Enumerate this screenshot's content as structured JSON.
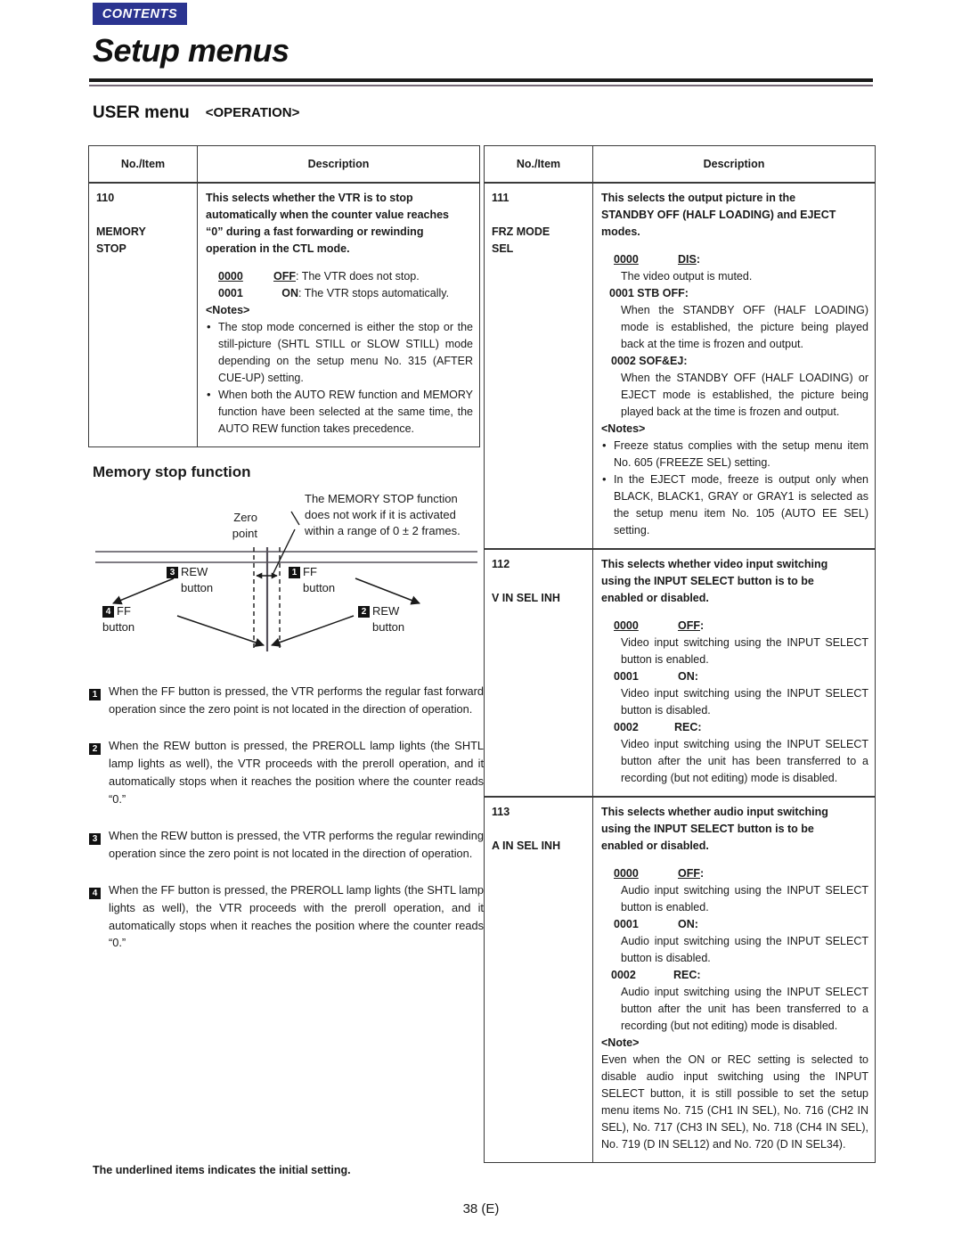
{
  "header": {
    "contents_badge": "CONTENTS",
    "title": "Setup menus",
    "section_title": "USER menu",
    "section_subtitle": "<OPERATION>"
  },
  "table_headers": {
    "col1": "No./Item",
    "col2": "Description"
  },
  "left_table": {
    "rows": [
      {
        "number": "110",
        "item": "MEMORY\nSTOP",
        "item_line1": "MEMORY",
        "item_line2": "STOP",
        "lead_lines": [
          "This selects whether the VTR is to stop",
          "automatically when the counter value reaches",
          "“0” during a fast forwarding or rewinding",
          "operation in the CTL mode."
        ],
        "options": [
          {
            "code": "0000",
            "code_underlined": true,
            "value": "OFF",
            "value_underlined": true,
            "text": ": The VTR does not stop."
          },
          {
            "code": "0001",
            "code_underlined": false,
            "value": "ON",
            "value_underlined": false,
            "text": ": The VTR stops automatically."
          }
        ],
        "notes_heading": "<Notes>",
        "notes": [
          "The stop mode concerned is either the stop or the still-picture (SHTL STILL or SLOW STILL) mode depending on the setup menu No. 315 (AFTER CUE-UP) setting.",
          "When both the AUTO REW function and MEMORY function have been selected at the same time, the AUTO REW function takes precedence."
        ]
      }
    ]
  },
  "right_table": {
    "rows": [
      {
        "number": "111",
        "item_line1": "FRZ MODE",
        "item_line2": "SEL",
        "lead_lines": [
          "This selects the output picture in the",
          "STANDBY OFF (HALF LOADING) and EJECT",
          "modes."
        ],
        "options": [
          {
            "code": "0000",
            "code_underlined": true,
            "value": "DIS",
            "value_underlined": true,
            "suffix": ":",
            "body": "The video output is muted."
          },
          {
            "code": "0001",
            "code_underlined": false,
            "value": "STB OFF",
            "value_underlined": false,
            "suffix": ":",
            "tight": true,
            "body": "When the STANDBY OFF (HALF LOADING) mode is established, the picture being played back at the time is frozen and output."
          },
          {
            "code": "0002",
            "code_underlined": false,
            "value": "SOF&EJ",
            "value_underlined": false,
            "suffix": ":",
            "tight": true,
            "body": "When the STANDBY OFF (HALF LOADING) or EJECT mode is established, the picture being played back at the time is frozen and output."
          }
        ],
        "notes_heading": "<Notes>",
        "notes": [
          "Freeze status complies with the setup menu item No. 605 (FREEZE SEL) setting.",
          "In the EJECT mode, freeze is output only when BLACK, BLACK1, GRAY or GRAY1 is selected as the setup menu item No. 105 (AUTO EE SEL) setting."
        ]
      },
      {
        "number": "112",
        "item_line1": "V IN SEL INH",
        "item_line2": "",
        "lead_lines": [
          "This selects whether video input switching",
          "using the INPUT SELECT button is to be",
          "enabled or disabled."
        ],
        "options": [
          {
            "code": "0000",
            "code_underlined": true,
            "value": "OFF",
            "value_underlined": true,
            "suffix": ":",
            "body": "Video input switching using the INPUT SELECT button is enabled."
          },
          {
            "code": "0001",
            "code_underlined": false,
            "value": "ON",
            "value_underlined": false,
            "suffix": ":",
            "body": "Video input switching using the INPUT SELECT button is disabled."
          },
          {
            "code": "0002",
            "code_underlined": false,
            "value": "REC",
            "value_underlined": false,
            "suffix": ":",
            "body": "Video input switching using the INPUT SELECT button after the unit has been transferred to a recording (but not editing) mode is disabled."
          }
        ],
        "notes_heading": "",
        "notes": []
      },
      {
        "number": "113",
        "item_line1": "A IN SEL INH",
        "item_line2": "",
        "lead_lines": [
          "This selects whether audio input switching",
          "using the INPUT SELECT button is to be",
          "enabled or disabled."
        ],
        "options": [
          {
            "code": "0000",
            "code_underlined": true,
            "value": "OFF",
            "value_underlined": true,
            "suffix": ":",
            "body": "Audio input switching using the INPUT SELECT button is enabled."
          },
          {
            "code": "0001",
            "code_underlined": false,
            "value": "ON",
            "value_underlined": false,
            "suffix": ":",
            "body": "Audio input switching using the INPUT SELECT button is disabled."
          },
          {
            "code": "0002",
            "code_underlined": false,
            "value": "REC",
            "value_underlined": false,
            "suffix": ":",
            "body": "Audio input switching using the INPUT SELECT button after the unit has been transferred to a recording (but not editing) mode is disabled."
          }
        ],
        "notes_heading": "<Note>",
        "note_paragraph": "Even when the ON or REC setting is selected to disable audio input switching using the INPUT SELECT button, it is still possible to set the setup menu items No. 715 (CH1 IN SEL), No. 716 (CH2 IN SEL), No. 717 (CH3 IN SEL), No. 718 (CH4 IN SEL), No. 719 (D IN SEL12) and No. 720 (D IN SEL34)."
      }
    ]
  },
  "memory_stop": {
    "title": "Memory stop function",
    "callout_lines": [
      "The MEMORY STOP function",
      "does not work if it is  activated",
      "within a range of 0 ± 2 frames."
    ],
    "zero_point_line1": "Zero",
    "zero_point_line2": "point",
    "labels": {
      "rew_top": {
        "num": "3",
        "name": "REW",
        "word": "button"
      },
      "ff_top": {
        "num": "1",
        "name": "FF",
        "word": "button"
      },
      "ff_bottom": {
        "num": "4",
        "name": "FF",
        "word": "button"
      },
      "rew_bottom": {
        "num": "2",
        "name": "REW",
        "word": "button"
      }
    }
  },
  "steps": [
    {
      "num": "1",
      "text": "When the FF button is pressed, the VTR performs the regular fast forward operation since the zero point is not located in the direction of operation."
    },
    {
      "num": "2",
      "text": "When the REW button is pressed, the PREROLL lamp lights (the SHTL lamp lights as well), the VTR proceeds with the preroll operation, and it automatically stops when it reaches the position where the counter reads “0.”"
    },
    {
      "num": "3",
      "text": "When the REW button is pressed, the VTR performs the regular rewinding operation since the zero point is not located in the direction of operation."
    },
    {
      "num": "4",
      "text": "When the FF button is pressed, the PREROLL lamp lights (the SHTL lamp lights as well), the VTR proceeds with the preroll operation, and it automatically stops when it reaches the position where the counter reads “0.”"
    }
  ],
  "footer": {
    "note": "The underlined items indicates the initial setting.",
    "page": "38 (E)"
  },
  "colors": {
    "badge": "#2b3490",
    "rule_accent": "#776a78",
    "text": "#1a1a1a"
  }
}
